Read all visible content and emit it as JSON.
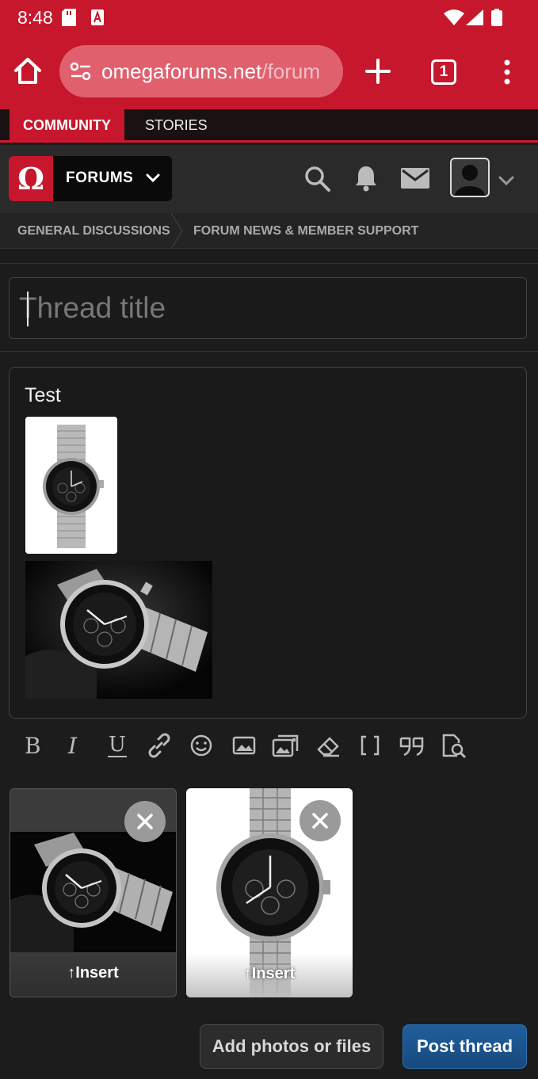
{
  "status_bar": {
    "time": "8:48"
  },
  "browser": {
    "url_host": "omegaforums.net",
    "url_path": "/forum",
    "tab_count": "1"
  },
  "site_nav": {
    "tabs": [
      {
        "label": "COMMUNITY",
        "active": true
      },
      {
        "label": "STORIES",
        "active": false
      }
    ]
  },
  "forum_bar": {
    "logo_glyph": "Ω",
    "section_label": "FORUMS",
    "icons": [
      "search-icon",
      "bell-icon",
      "mail-icon",
      "avatar",
      "chevron-down-icon"
    ]
  },
  "breadcrumb": [
    "GENERAL DISCUSSIONS",
    "FORUM NEWS & MEMBER SUPPORT"
  ],
  "thread_form": {
    "title_placeholder": "Thread title",
    "title_value": "",
    "body_text": "Test",
    "toolbar": [
      "bold-icon",
      "italic-icon",
      "underline-icon",
      "link-icon",
      "emoji-icon",
      "image-icon",
      "media-gallery-icon",
      "eraser-icon",
      "brackets-icon",
      "quote-icon",
      "preview-icon"
    ],
    "attachments": [
      {
        "kind": "dark-watch-photo",
        "insert_label": "Insert"
      },
      {
        "kind": "white-watch-photo",
        "insert_label": "Insert"
      }
    ],
    "add_files_label": "Add photos or files",
    "submit_label": "Post thread"
  },
  "colors": {
    "brand_red": "#c6172d",
    "submit_blue": "#1f5f9c",
    "background": "#1c1c1c"
  }
}
